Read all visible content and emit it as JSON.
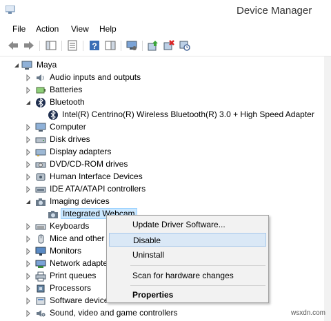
{
  "window": {
    "title": "Device Manager",
    "watermark": "wsxdn.com"
  },
  "menu": [
    "File",
    "Action",
    "View",
    "Help"
  ],
  "toolbar": [
    "back-arrow-icon",
    "forward-arrow-icon",
    "console-tree-icon",
    "properties-sheet-icon",
    "help-icon",
    "action-pane-icon",
    "monitor-icon",
    "update-driver-icon",
    "uninstall-device-icon",
    "scan-hardware-icon"
  ],
  "tree": {
    "root": "Maya",
    "items": [
      {
        "label": "Audio inputs and outputs",
        "icon": "speaker-icon",
        "expanded": false
      },
      {
        "label": "Batteries",
        "icon": "battery-icon",
        "expanded": false
      },
      {
        "label": "Bluetooth",
        "icon": "bluetooth-icon",
        "expanded": true
      },
      {
        "label": "Intel(R) Centrino(R) Wireless Bluetooth(R) 3.0 + High Speed Adapter",
        "icon": "bluetooth-icon",
        "child": true
      },
      {
        "label": "Computer",
        "icon": "computer-icon",
        "expanded": false
      },
      {
        "label": "Disk drives",
        "icon": "disk-drive-icon",
        "expanded": false
      },
      {
        "label": "Display adapters",
        "icon": "display-adapter-icon",
        "expanded": false
      },
      {
        "label": "DVD/CD-ROM drives",
        "icon": "dvd-drive-icon",
        "expanded": false
      },
      {
        "label": "Human Interface Devices",
        "icon": "hid-icon",
        "expanded": false
      },
      {
        "label": "IDE ATA/ATAPI controllers",
        "icon": "ide-controller-icon",
        "expanded": false
      },
      {
        "label": "Imaging devices",
        "icon": "camera-icon",
        "expanded": true
      },
      {
        "label": "Integrated Webcam",
        "icon": "webcam-icon",
        "child": true,
        "selected": true
      },
      {
        "label": "Keyboards",
        "icon": "keyboard-icon",
        "expanded": false
      },
      {
        "label": "Mice and other p",
        "icon": "mouse-icon",
        "expanded": false
      },
      {
        "label": "Monitors",
        "icon": "monitor-icon",
        "expanded": false
      },
      {
        "label": "Network adapte",
        "icon": "network-adapter-icon",
        "expanded": false
      },
      {
        "label": "Print queues",
        "icon": "printer-icon",
        "expanded": false
      },
      {
        "label": "Processors",
        "icon": "processor-icon",
        "expanded": false
      },
      {
        "label": "Software devices",
        "icon": "software-device-icon",
        "expanded": false
      },
      {
        "label": "Sound, video and game controllers",
        "icon": "sound-controller-icon",
        "expanded": false
      }
    ]
  },
  "context_menu": {
    "items": [
      "Update Driver Software...",
      "Disable",
      "Uninstall",
      "Scan for hardware changes",
      "Properties"
    ],
    "highlighted": "Disable",
    "bold": "Properties"
  },
  "colors": {
    "selection": "#cce8ff",
    "menu_bg": "#f2f2f2",
    "menu_highlight": "#dae8f6"
  }
}
